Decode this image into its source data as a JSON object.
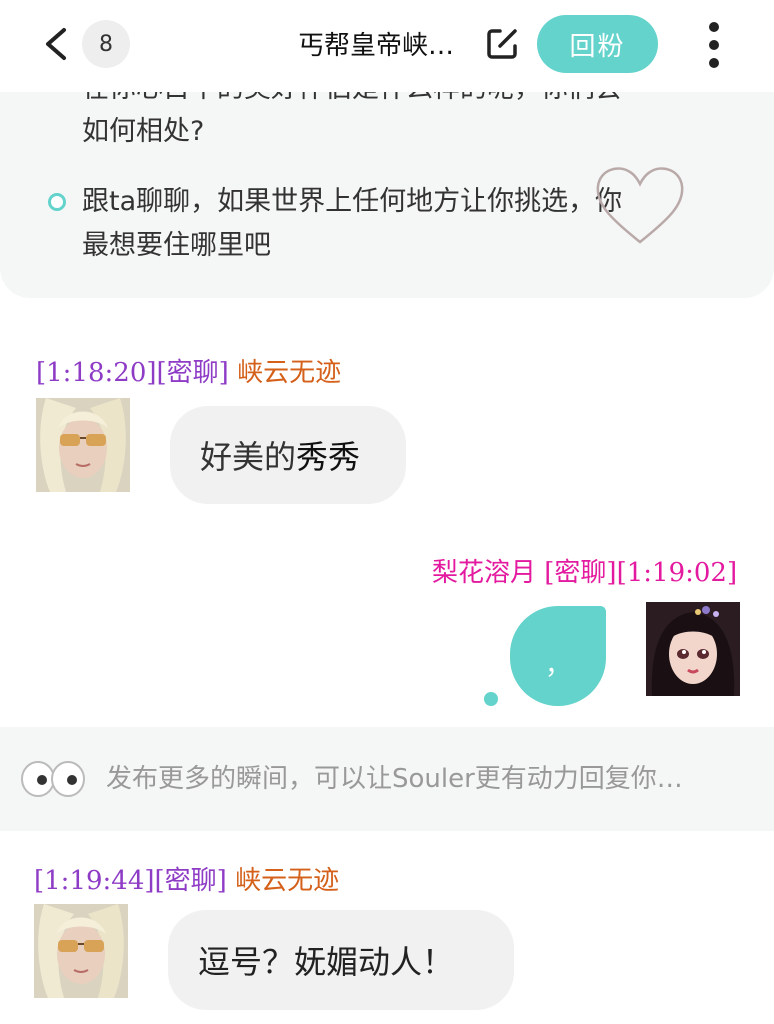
{
  "header": {
    "unread_count": "8",
    "title": "丐帮皇帝峡…",
    "follow_back_label": "回粉"
  },
  "topic_card": {
    "partial_line": "在你心目中的美好伴侣是什么样的呢，你们会",
    "line_continued": "如何相处?",
    "suggestion_line_1": "跟ta聊聊，如果世界上任何地方让你挑选，你",
    "suggestion_line_2": "最想要住哪里吧"
  },
  "messages": [
    {
      "time": "[1:18:20]",
      "tag": "[密聊]",
      "sender": "峡云无迹",
      "text_prefix": "好美的",
      "text_emph": "秀秀",
      "side": "left"
    },
    {
      "sender": "梨花溶月",
      "tag": "[密聊]",
      "time": "[1:19:02]",
      "text": "，",
      "side": "right"
    },
    {
      "time": "[1:19:44]",
      "tag": "[密聊]",
      "sender": "峡云无迹",
      "text": "逗号？妩媚动人！",
      "side": "left"
    }
  ],
  "notice": {
    "text": "发布更多的瞬间，可以让Souler更有动力回复你…"
  },
  "colors": {
    "accent": "#63d3cc",
    "meta_purple": "#8e3bc6",
    "name_orange": "#d4601a",
    "name_pink": "#e31a9f"
  },
  "icons": [
    "back-icon",
    "edit-icon",
    "more-icon",
    "heart-icon",
    "eyes-icon"
  ]
}
